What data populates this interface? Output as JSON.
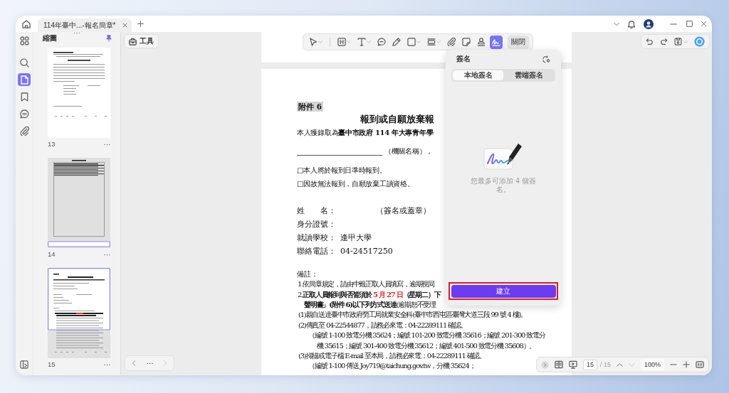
{
  "tab": {
    "title": "114年臺中...-報名簡章*"
  },
  "sidebar": {
    "rail": [
      {
        "selected": false
      },
      {
        "selected": false
      },
      {
        "selected": true
      },
      {
        "selected": false
      },
      {
        "selected": false
      },
      {
        "selected": false
      }
    ],
    "title": "縮圖",
    "pinned": true,
    "thumbnails": [
      {
        "page": "13",
        "top_in_view": false,
        "bottom_in_view": false
      },
      {
        "page": "14",
        "top_in_view": false,
        "bottom_in_view": true
      },
      {
        "page": "15",
        "top_in_view": true,
        "bottom_in_view": false
      }
    ]
  },
  "tools_button": {
    "label": "工具"
  },
  "toolbar": {
    "tools": [
      {
        "menu": true,
        "selected": false
      },
      {
        "menu": true,
        "selected": false
      },
      {
        "menu": true,
        "selected": false
      },
      {
        "menu": false,
        "selected": false
      },
      {
        "menu": false,
        "selected": false
      },
      {
        "menu": true,
        "selected": false
      },
      {
        "menu": true,
        "selected": false
      },
      {
        "menu": false,
        "selected": false
      },
      {
        "menu": false,
        "selected": false
      },
      {
        "menu": false,
        "selected": false
      },
      {
        "menu": false,
        "selected": true
      }
    ],
    "close_label": "關閉"
  },
  "document": {
    "lines": [
      {
        "kind": "tag",
        "text": "附件 6"
      },
      {
        "kind": "title",
        "text": "報到或自願放棄報"
      },
      {
        "kind": "text",
        "text": "本人獲錄取為**臺中市政府 114 年大專青年學**"
      },
      {
        "kind": "blank",
        "text": "（機關名稱），"
      },
      {
        "kind": "text",
        "text": "□本人將於報到日準時報到。"
      },
      {
        "kind": "text",
        "text": "□因故無法報到，自願放棄工讀資格。"
      },
      {
        "kind": "sign_field",
        "label": "姓　　名：",
        "value": "（簽名或蓋章）"
      },
      {
        "kind": "field",
        "label": "身分證號："
      },
      {
        "kind": "field",
        "label": "就讀學校：",
        "value": "逢甲大學"
      },
      {
        "kind": "field",
        "label": "聯絡電話：",
        "value": "04-24517250"
      },
      {
        "kind": "note_heading",
        "text": "備註："
      },
      {
        "kind": "note",
        "text": "1.依簡章規定，請由中籤正取人員填寫，逾期視同"
      },
      {
        "kind": "note",
        "segments": [
          {
            "text": "2.**正取人員報到與否皆須於** ",
            "highlighted": false
          },
          {
            "text": "**5 月 27 日**",
            "highlighted": true
          },
          {
            "text": "**（星期二）下**",
            "highlighted": false
          }
        ]
      },
      {
        "kind": "note_continued",
        "text": "**聲明書」(附件 6)以下列方式送達**(逾期恕不受理"
      },
      {
        "kind": "sub_note",
        "text": "(1)親自送達臺中市政府勞工局就業安全科(臺中市西屯區臺灣大道三段 99 號 4 樓)。"
      },
      {
        "kind": "sub_note",
        "text": "(2)傳真至 04-22544877，請務必來電：04-22289111 確認。"
      },
      {
        "kind": "sub_detail",
        "text": "（編號 1-100 致電分機 35624；編號 101-200 致電分機 35616；編號 201-300 致電分"
      },
      {
        "kind": "sub_detail_continued",
        "text": "機 35615；編號 301-400 致電分機 35612；編號 401-500 致電分機 35608）。"
      },
      {
        "kind": "sub_note",
        "text": "(3)掃描或電子檔 E-mail 至本局，請務必來電：04-22289111 確認。"
      },
      {
        "kind": "sub_detail",
        "text": "（編號 1-100 傳送 Joy719@taichung.gov.tw，分機 35624；"
      }
    ]
  },
  "signature_panel": {
    "title": "簽名",
    "tabs": [
      {
        "label": "本地簽名",
        "selected": true
      },
      {
        "label": "雲端簽名",
        "selected": false
      }
    ],
    "message": "您最多可添加 4 個簽名。",
    "create": {
      "label": "建立",
      "highlighted": true
    }
  },
  "history": {
    "back_disabled": false,
    "forward_disabled": true
  },
  "page_nav": {
    "page": "15",
    "total": "/ 15",
    "prev_disabled": false,
    "next_disabled": true,
    "zoom": "100%"
  }
}
